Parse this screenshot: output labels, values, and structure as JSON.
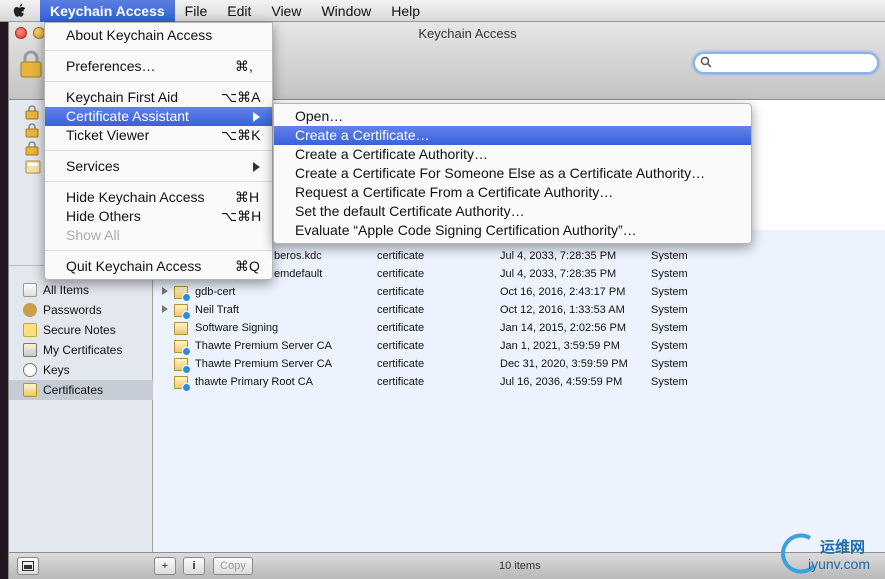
{
  "menubar": {
    "app": "Keychain Access",
    "items": [
      "File",
      "Edit",
      "View",
      "Window",
      "Help"
    ]
  },
  "window": {
    "title": "Keychain Access"
  },
  "app_menu": {
    "items": [
      {
        "label": "About Keychain Access",
        "shortcut": ""
      },
      {
        "label": "Preferences…",
        "shortcut": "⌘,"
      },
      {
        "label": "Keychain First Aid",
        "shortcut": "⌥⌘A"
      },
      {
        "label": "Certificate Assistant",
        "shortcut": ""
      },
      {
        "label": "Ticket Viewer",
        "shortcut": "⌥⌘K"
      },
      {
        "label": "Services",
        "shortcut": ""
      },
      {
        "label": "Hide Keychain Access",
        "shortcut": "⌘H"
      },
      {
        "label": "Hide Others",
        "shortcut": "⌥⌘H"
      },
      {
        "label": "Show All",
        "shortcut": ""
      },
      {
        "label": "Quit Keychain Access",
        "shortcut": "⌘Q"
      }
    ]
  },
  "cert_submenu": {
    "items": [
      "Open…",
      "Create a Certificate…",
      "Create a Certificate Authority…",
      "Create a Certificate For Someone Else as a Certificate Authority…",
      "Request a Certificate From a Certificate Authority…",
      "Set the default Certificate Authority…",
      "Evaluate “Apple Code Signing Certification Authority”…"
    ]
  },
  "category": {
    "items": [
      "All Items",
      "Passwords",
      "Secure Notes",
      "My Certificates",
      "Keys",
      "Certificates"
    ]
  },
  "list": {
    "rows": [
      {
        "name": "beros.kdc",
        "kind": "certificate",
        "expires": "Jul 4, 2033, 7:28:35 PM",
        "keychain": "System"
      },
      {
        "name": "emdefault",
        "kind": "certificate",
        "expires": "Jul 4, 2033, 7:28:35 PM",
        "keychain": "System"
      },
      {
        "name": "gdb-cert",
        "kind": "certificate",
        "expires": "Oct 16, 2016, 2:43:17 PM",
        "keychain": "System"
      },
      {
        "name": "Neil Traft",
        "kind": "certificate",
        "expires": "Oct 12, 2016, 1:33:53 AM",
        "keychain": "System"
      },
      {
        "name": "Software Signing",
        "kind": "certificate",
        "expires": "Jan 14, 2015, 2:02:56 PM",
        "keychain": "System"
      },
      {
        "name": "Thawte Premium Server CA",
        "kind": "certificate",
        "expires": "Jan 1, 2021, 3:59:59 PM",
        "keychain": "System"
      },
      {
        "name": "Thawte Premium Server CA",
        "kind": "certificate",
        "expires": "Dec 31, 2020, 3:59:59 PM",
        "keychain": "System"
      },
      {
        "name": "thawte Primary Root CA",
        "kind": "certificate",
        "expires": "Jul 16, 2036, 4:59:59 PM",
        "keychain": "System"
      }
    ]
  },
  "bottom": {
    "plus": "+",
    "info": "i",
    "copy": "Copy",
    "count": "10 items"
  },
  "watermark": {
    "line1": "运维网",
    "line2": "iyunv.com"
  },
  "colors": {
    "selection": "#3862dc",
    "stripe": "#edf3fe"
  }
}
